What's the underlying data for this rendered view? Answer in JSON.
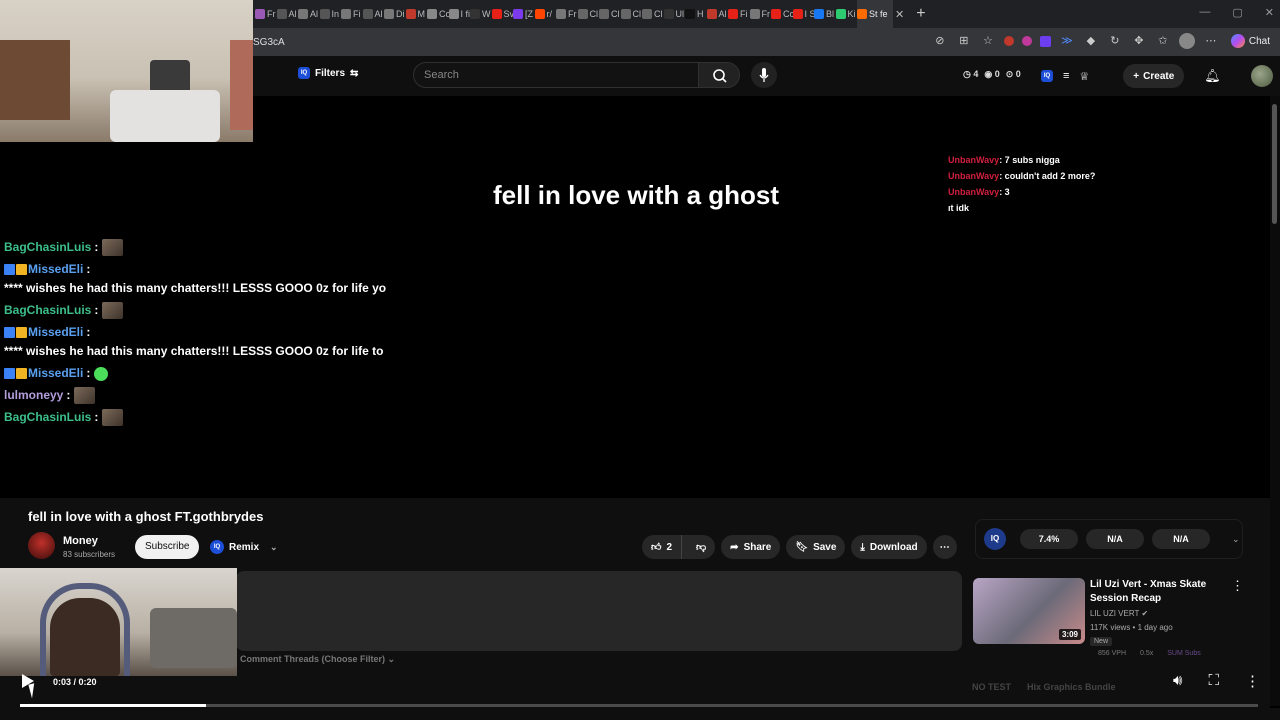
{
  "browser": {
    "tabs": [
      "Fr",
      "Al",
      "Al",
      "In",
      "Fi",
      "Al",
      "Di",
      "M",
      "Co",
      "I fi",
      "W",
      "Sv",
      "[Z",
      "r/",
      "Fr",
      "Cl",
      "Cl",
      "Cl",
      "Cl",
      "Ul",
      "H",
      "Al",
      "Fi",
      "Fr",
      "Cc",
      "I S",
      "Bl",
      "Ki",
      "St fe"
    ],
    "tab_colors": [
      "#9b59b6",
      "#555",
      "#777",
      "#555",
      "#777",
      "#555",
      "#777",
      "#c0392b",
      "#888",
      "#888",
      "#333",
      "#e62117",
      "#7c3aed",
      "#ff4500",
      "#777",
      "#666",
      "#666",
      "#666",
      "#666",
      "#333",
      "#111",
      "#c0392b",
      "#e62117",
      "#777",
      "#e62117",
      "#e62117",
      "#1877f2",
      "#2ecc71",
      "#ff6b00"
    ],
    "url": "SG3cA",
    "chat_label": "Chat"
  },
  "masthead": {
    "filters_label": "Filters",
    "iq_label": "IQ",
    "search_placeholder": "Search",
    "stats": [
      "4",
      "0",
      "0"
    ],
    "create_label": "Create"
  },
  "video": {
    "overlay_title": "fell in love with a ghost",
    "chat": [
      {
        "user": "BagChasinLuis",
        "color": "#3dbf8a",
        "badges": [],
        "text": "",
        "emote": "face"
      },
      {
        "user": "MissedEli",
        "color": "#5aa0f0",
        "badges": [
          "#3b82f6",
          "#f0b323"
        ],
        "text": "**** wishes he had this many chatters!!! LESSS GOOO 0z for life yo",
        "emote": ""
      },
      {
        "user": "BagChasinLuis",
        "color": "#3dbf8a",
        "badges": [],
        "text": "",
        "emote": "face"
      },
      {
        "user": "MissedEli",
        "color": "#5aa0f0",
        "badges": [
          "#3b82f6",
          "#f0b323"
        ],
        "text": "**** wishes he had this many chatters!!! LESSS GOOO 0z for life to",
        "emote": ""
      },
      {
        "user": "MissedEli",
        "color": "#5aa0f0",
        "badges": [
          "#3b82f6",
          "#f0b323"
        ],
        "text": "",
        "emote": "green"
      },
      {
        "user": "lulmoneyy",
        "color": "#b39ddb",
        "badges": [],
        "text": "",
        "emote": "face"
      },
      {
        "user": "BagChasinLuis",
        "color": "#3dbf8a",
        "badges": [],
        "text": "",
        "emote": "face"
      }
    ],
    "side_chat": [
      {
        "user": "UnbanWavy",
        "text": ": 7 subs nigga"
      },
      {
        "user": "UnbanWavy",
        "text": ": couldn't add 2 more?"
      },
      {
        "user": "UnbanWavy",
        "text": ": 3"
      },
      {
        "user": "",
        "text": "ıt idk"
      }
    ],
    "title": "fell in love with a ghost FT.gothbrydes",
    "channel_name": "Money",
    "channel_subs": "83 subscribers",
    "subscribe_label": "Subscribe",
    "remix_label": "Remix",
    "like_count": "2",
    "share_label": "Share",
    "save_label": "Save",
    "download_label": "Download",
    "comment_threads_label": "Comment Threads (Choose Filter)"
  },
  "extension": {
    "iq_label": "IQ",
    "stats": [
      "7.4%",
      "N/A",
      "N/A"
    ]
  },
  "recommendation": {
    "title": "Lil Uzi Vert - Xmas Skate Session Recap",
    "channel": "LIL UZI VERT",
    "meta": "117K views • 1 day ago",
    "badge": "New",
    "duration": "3:09",
    "vph": "856 VPH",
    "ratio": "0.5x",
    "subs": "SUM Subs"
  },
  "faded_row": [
    "NO TEST",
    "Hix Graphics Bundle"
  ],
  "player": {
    "time": "0:03 / 0:20",
    "progress": 0.15
  }
}
